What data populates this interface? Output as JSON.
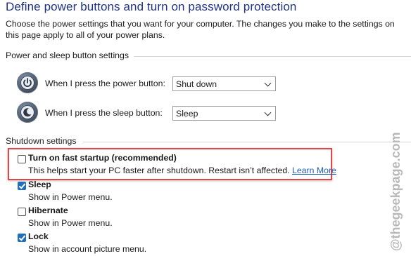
{
  "page": {
    "title": "Define power buttons and turn on password protection",
    "description": "Choose the power settings that you want for your computer. The changes you make to the settings on this page apply to all of your power plans."
  },
  "power_section": {
    "heading": "Power and sleep button settings",
    "power_button": {
      "label": "When I press the power button:",
      "value": "Shut down",
      "icon": "power-icon"
    },
    "sleep_button": {
      "label": "When I press the sleep button:",
      "value": "Sleep",
      "icon": "sleep-icon"
    }
  },
  "shutdown_section": {
    "heading": "Shutdown settings",
    "fast_startup": {
      "label": "Turn on fast startup (recommended)",
      "description": "This helps start your PC faster after shutdown. Restart isn’t affected.",
      "link": "Learn More",
      "checked": false
    },
    "sleep": {
      "label": "Sleep",
      "description": "Show in Power menu.",
      "checked": true
    },
    "hibernate": {
      "label": "Hibernate",
      "description": "Show in Power menu.",
      "checked": false
    },
    "lock": {
      "label": "Lock",
      "description": "Show in account picture menu.",
      "checked": true
    }
  },
  "watermark": "@thegeekpage.com",
  "colors": {
    "title": "#1e3287",
    "highlight": "#e0454a",
    "checkbox": "#1f6fbf",
    "link": "#1f5fb0"
  }
}
